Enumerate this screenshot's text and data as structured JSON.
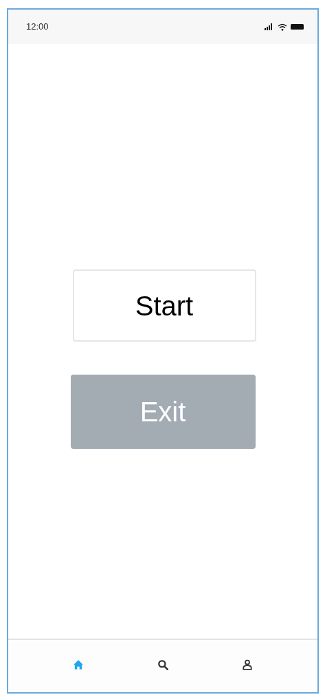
{
  "status_bar": {
    "time": "12:00"
  },
  "buttons": [
    {
      "label": "Start",
      "kind": "outline"
    },
    {
      "label": "Exit",
      "kind": "filled"
    }
  ],
  "nav_items": [
    {
      "kind": "home",
      "selected": true
    },
    {
      "kind": "search",
      "selected": false
    },
    {
      "kind": "profile",
      "selected": false
    }
  ]
}
